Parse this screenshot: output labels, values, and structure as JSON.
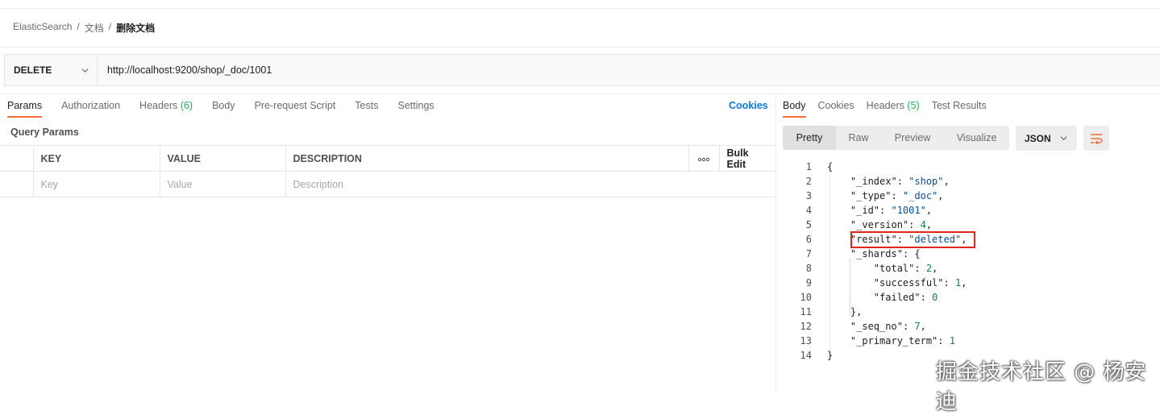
{
  "breadcrumb": {
    "root": "ElasticSearch",
    "parent": "文档",
    "current": "删除文档",
    "separator": "/"
  },
  "request": {
    "method": "DELETE",
    "url": "http://localhost:9200/shop/_doc/1001"
  },
  "request_tabs": [
    {
      "label": "Params"
    },
    {
      "label": "Authorization"
    },
    {
      "label": "Headers",
      "count": "(6)"
    },
    {
      "label": "Body"
    },
    {
      "label": "Pre-request Script"
    },
    {
      "label": "Tests"
    },
    {
      "label": "Settings"
    }
  ],
  "cookies_link": "Cookies",
  "query_params": {
    "title": "Query Params",
    "columns": {
      "key": "KEY",
      "value": "VALUE",
      "description": "DESCRIPTION",
      "more": "ooo",
      "bulk": "Bulk Edit"
    },
    "placeholders": {
      "key": "Key",
      "value": "Value",
      "description": "Description"
    }
  },
  "response_tabs": [
    {
      "label": "Body"
    },
    {
      "label": "Cookies"
    },
    {
      "label": "Headers",
      "count": "(5)"
    },
    {
      "label": "Test Results"
    }
  ],
  "view_modes": [
    "Pretty",
    "Raw",
    "Preview",
    "Visualize"
  ],
  "format": "JSON",
  "response_lines": [
    {
      "n": "1",
      "text": "{"
    },
    {
      "n": "2",
      "key": "\"_index\"",
      "val": "\"shop\"",
      "type": "s",
      "tail": ","
    },
    {
      "n": "3",
      "key": "\"_type\"",
      "val": "\"_doc\"",
      "type": "s",
      "tail": ","
    },
    {
      "n": "4",
      "key": "\"_id\"",
      "val": "\"1001\"",
      "type": "s",
      "tail": ","
    },
    {
      "n": "5",
      "key": "\"_version\"",
      "val": "4",
      "type": "n",
      "tail": ","
    },
    {
      "n": "6",
      "key": "\"result\"",
      "val": "\"deleted\"",
      "type": "s",
      "tail": ","
    },
    {
      "n": "7",
      "key": "\"_shards\"",
      "val": "{",
      "type": "p",
      "tail": ""
    },
    {
      "n": "8",
      "key": "\"total\"",
      "val": "2",
      "type": "n",
      "tail": ",",
      "indent": 2
    },
    {
      "n": "9",
      "key": "\"successful\"",
      "val": "1",
      "type": "n",
      "tail": ",",
      "indent": 2
    },
    {
      "n": "10",
      "key": "\"failed\"",
      "val": "0",
      "type": "n",
      "tail": "",
      "indent": 2
    },
    {
      "n": "11",
      "text": "    },"
    },
    {
      "n": "12",
      "key": "\"_seq_no\"",
      "val": "7",
      "type": "n",
      "tail": ","
    },
    {
      "n": "13",
      "key": "\"_primary_term\"",
      "val": "1",
      "type": "n",
      "tail": ""
    },
    {
      "n": "14",
      "text": "}"
    }
  ],
  "watermark": "掘金技术社区 @ 杨安迪",
  "colors": {
    "accent": "#ff6c37",
    "link": "#097bed",
    "count": "#0cbb52",
    "highlight_box": "#e0251d"
  }
}
